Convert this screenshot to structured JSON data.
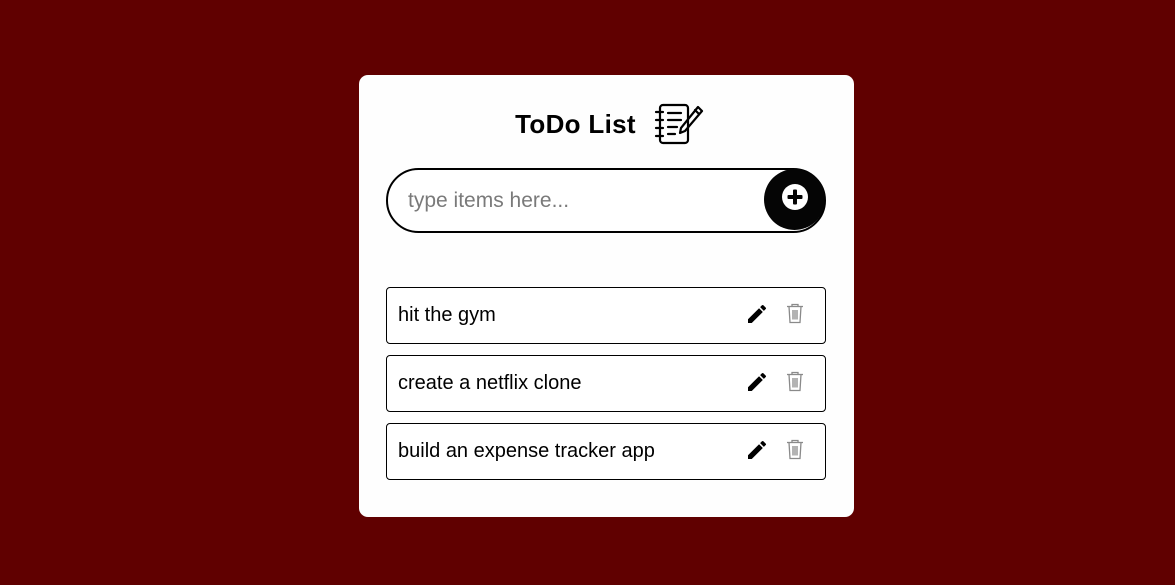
{
  "app": {
    "title": "ToDo List",
    "title_icon": "notebook-pen-icon"
  },
  "colors": {
    "background": "#600000",
    "card": "#fefefe",
    "accent": "#050505"
  },
  "input": {
    "value": "",
    "placeholder": "type items here...",
    "add_icon": "plus-circle-icon"
  },
  "todos": [
    {
      "text": "hit the gym",
      "edit_icon": "pencil-icon",
      "delete_icon": "trash-icon"
    },
    {
      "text": "create a netflix clone",
      "edit_icon": "pencil-icon",
      "delete_icon": "trash-icon"
    },
    {
      "text": "build an expense tracker app",
      "edit_icon": "pencil-icon",
      "delete_icon": "trash-icon"
    }
  ]
}
